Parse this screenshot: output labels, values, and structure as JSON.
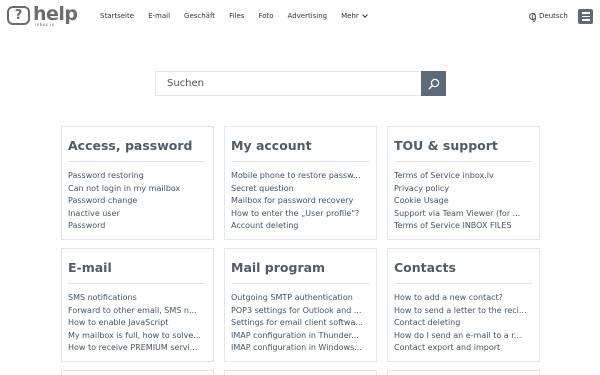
{
  "header": {
    "logo_text": "help",
    "logo_sub": "inbox.lv",
    "nav": [
      "Startseite",
      "E-mail",
      "Geschäft",
      "Files",
      "Foto",
      "Advertising"
    ],
    "more_label": "Mehr",
    "language": "Deutsch"
  },
  "search": {
    "placeholder": "Suchen"
  },
  "cards": [
    {
      "title": "Access, password",
      "items": [
        "Password restoring",
        "Can not login in my mailbox",
        "Password change",
        "Inactive user",
        "Password"
      ]
    },
    {
      "title": "My account",
      "items": [
        "Mobile phone to restore passw...",
        "Secret question",
        "Mailbox for password recovery",
        "How to enter the „User profile\"?",
        "Account deleting"
      ]
    },
    {
      "title": "TOU & support",
      "items": [
        "Terms of Service inbox.lv",
        "Privacy policy",
        "Cookie Usage",
        "Support via Team Viewer (for ...",
        "Terms of Service INBOX FILES"
      ]
    },
    {
      "title": "E-mail",
      "items": [
        "SMS notifications",
        "Forward to other email, SMS n...",
        "How to enable JavaScript",
        "My mailbox is full, how to solve...",
        "How to receive PREMIUM servi..."
      ]
    },
    {
      "title": "Mail program",
      "items": [
        "Outgoing SMTP authentication",
        "POP3 settings for Outlook and ...",
        "Settings for email client softwa...",
        "IMAP configuration in Thunder...",
        "IMAP configuration in Windows..."
      ]
    },
    {
      "title": "Contacts",
      "items": [
        "How to add a new contact?",
        "How to send a letter to the reci...",
        "Contact deleting",
        "How do I send an e-mail to a r...",
        "Contact export and import"
      ]
    }
  ]
}
